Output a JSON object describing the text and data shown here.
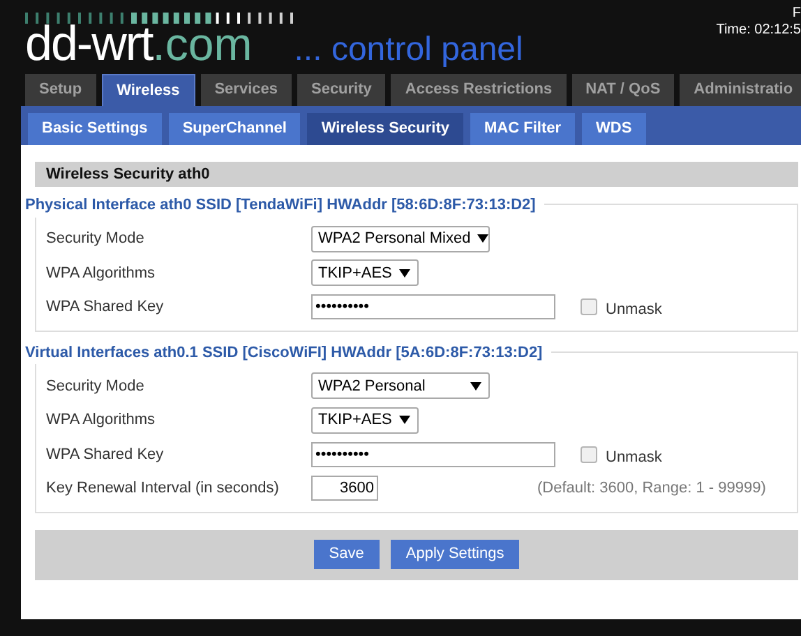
{
  "header": {
    "logo_main": "dd-wrt",
    "logo_domain": ".com",
    "tagline": "... control panel",
    "status_lines": [
      "F",
      "Time: 02:12:5"
    ]
  },
  "main_tabs": [
    {
      "label": "Setup",
      "selected": false
    },
    {
      "label": "Wireless",
      "selected": true
    },
    {
      "label": "Services",
      "selected": false
    },
    {
      "label": "Security",
      "selected": false
    },
    {
      "label": "Access Restrictions",
      "selected": false
    },
    {
      "label": "NAT / QoS",
      "selected": false
    },
    {
      "label": "Administratio",
      "selected": false
    }
  ],
  "sub_tabs": [
    {
      "label": "Basic Settings",
      "selected": false
    },
    {
      "label": "SuperChannel",
      "selected": false
    },
    {
      "label": "Wireless Security",
      "selected": true
    },
    {
      "label": "MAC Filter",
      "selected": false
    },
    {
      "label": "WDS",
      "selected": false
    }
  ],
  "section_title": "Wireless Security ath0",
  "interfaces": [
    {
      "title": "Physical Interface ath0 SSID [TendaWiFi] HWAddr [58:6D:8F:73:13:D2]",
      "fields": [
        {
          "kind": "select",
          "label": "Security Mode",
          "value": "WPA2 Personal Mixed"
        },
        {
          "kind": "select",
          "label": "WPA Algorithms",
          "value": "TKIP+AES"
        },
        {
          "kind": "password",
          "label": "WPA Shared Key",
          "value": "••••••••••",
          "unmask_label": "Unmask",
          "unmask_checked": false
        }
      ]
    },
    {
      "title": "Virtual Interfaces ath0.1 SSID [CiscoWiFI] HWAddr [5A:6D:8F:73:13:D2]",
      "fields": [
        {
          "kind": "select",
          "label": "Security Mode",
          "value": "WPA2 Personal"
        },
        {
          "kind": "select",
          "label": "WPA Algorithms",
          "value": "TKIP+AES"
        },
        {
          "kind": "password",
          "label": "WPA Shared Key",
          "value": "••••••••••",
          "unmask_label": "Unmask",
          "unmask_checked": false
        },
        {
          "kind": "number",
          "label": "Key Renewal Interval (in seconds)",
          "value": "3600",
          "hint": "(Default: 3600, Range: 1 - 99999)"
        }
      ]
    }
  ],
  "buttons": [
    "Save",
    "Apply Settings"
  ]
}
